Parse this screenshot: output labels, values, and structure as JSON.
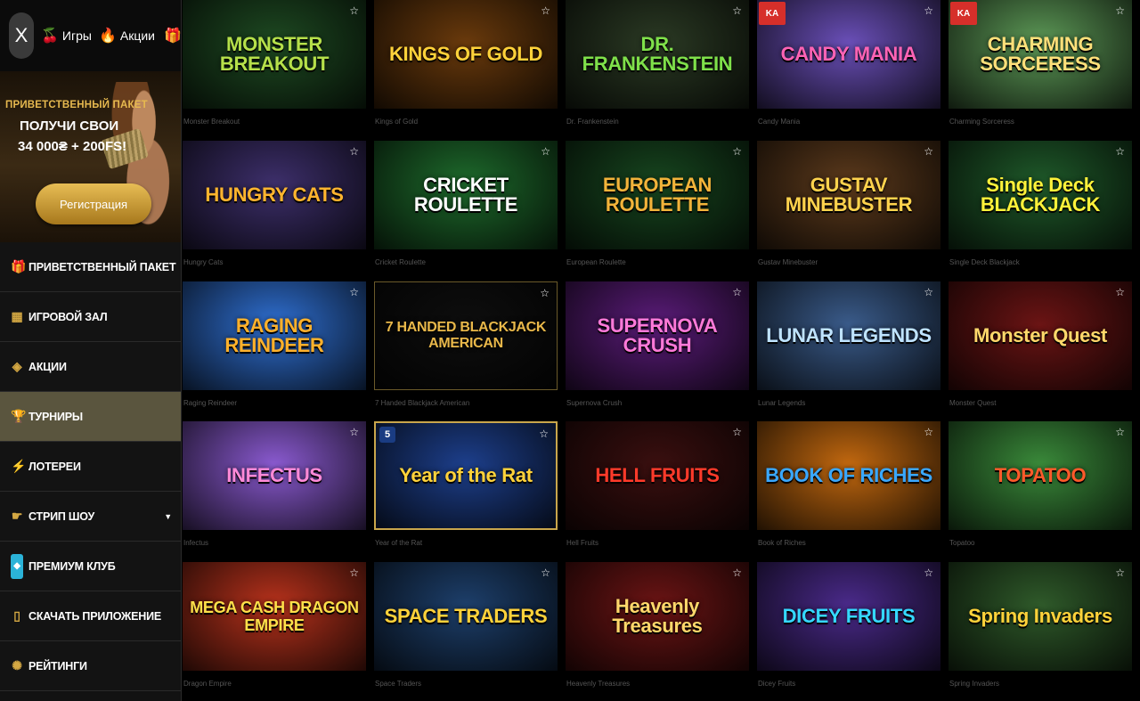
{
  "topbar": {
    "close_label": "X",
    "games_label": "Игры",
    "promos_label": "Акции"
  },
  "promo": {
    "title": "ПРИВЕТСТВЕННЫЙ ПАКЕТ",
    "line1": "ПОЛУЧИ СВОИ",
    "line2": "34 000₴ + 200FS!",
    "button": "Регистрация"
  },
  "menu": [
    {
      "label": "ПРИВЕТСТВЕННЫЙ ПАКЕТ",
      "icon": "gift-icon"
    },
    {
      "label": "ИГРОВОЙ ЗАЛ",
      "icon": "slots-icon"
    },
    {
      "label": "АКЦИИ",
      "icon": "tag-icon"
    },
    {
      "label": "ТУРНИРЫ",
      "icon": "trophy-icon",
      "active": true
    },
    {
      "label": "ЛОТЕРЕИ",
      "icon": "lottery-icon"
    },
    {
      "label": "СТРИП ШОУ",
      "icon": "strip-icon",
      "caret": "▼"
    },
    {
      "label": "ПРЕМИУМ КЛУБ",
      "icon": "club-icon"
    },
    {
      "label": "СКАЧАТЬ ПРИЛОЖЕНИЕ",
      "icon": "phone-icon"
    },
    {
      "label": "РЕЙТИНГИ",
      "icon": "ratings-icon"
    }
  ],
  "games": [
    {
      "title": "MONSTER BREAKOUT",
      "caption": "Monster Breakout",
      "bg": "#1e4a22",
      "fg": "#b6e04a"
    },
    {
      "title": "KINGS OF GOLD",
      "caption": "Kings of Gold",
      "bg": "#6a3a0c",
      "fg": "#ffd23a"
    },
    {
      "title": "DR. FRANKENSTEIN",
      "caption": "Dr. Frankenstein",
      "bg": "#2b3a24",
      "fg": "#7fe04a"
    },
    {
      "title": "CANDY MANIA",
      "caption": "Candy Mania",
      "bg": "#6a4fb8",
      "fg": "#ff63b5"
    },
    {
      "title": "CHARMING SORCERESS",
      "caption": "Charming Sorceress",
      "bg": "#5d9a57",
      "fg": "#ffe07a"
    },
    {
      "title": "HUNGRY CATS",
      "caption": "Hungry Cats",
      "bg": "#3d2f6b",
      "fg": "#ffb52e"
    },
    {
      "title": "CRICKET ROULETTE",
      "caption": "Cricket Roulette",
      "bg": "#1e6b2c",
      "fg": "#ffffff"
    },
    {
      "title": "EUROPEAN ROULETTE",
      "caption": "European Roulette",
      "bg": "#17461f",
      "fg": "#f2b33a"
    },
    {
      "title": "GUSTAV MINEBUSTER",
      "caption": "Gustav Minebuster",
      "bg": "#5c3a1c",
      "fg": "#ffd34d"
    },
    {
      "title": "Single Deck BLACKJACK",
      "caption": "Single Deck Blackjack",
      "bg": "#1f5a2a",
      "fg": "#fff23a"
    },
    {
      "title": "RAGING REINDEER",
      "caption": "Raging Reindeer",
      "bg": "#2f6fd1",
      "fg": "#ffb12b"
    },
    {
      "title": "7 HANDED BLACKJACK AMERICAN",
      "caption": "7 Handed Blackjack American",
      "bg": "#0e0e0e",
      "fg": "#e9b84a"
    },
    {
      "title": "SUPERNOVA CRUSH",
      "caption": "Supernova Crush",
      "bg": "#5b1c7a",
      "fg": "#ff7ad9"
    },
    {
      "title": "LUNAR LEGENDS",
      "caption": "Lunar Legends",
      "bg": "#3a5b8a",
      "fg": "#bfe3ff"
    },
    {
      "title": "Monster Quest",
      "caption": "Monster Quest",
      "bg": "#6b1414",
      "fg": "#ffd86b"
    },
    {
      "title": "INFECTUS",
      "caption": "Infectus",
      "bg": "#8a5ad0",
      "fg": "#ff8ad8"
    },
    {
      "title": "Year of the Rat",
      "caption": "Year of the Rat",
      "bg": "#1d3f8c",
      "fg": "#ffd23a"
    },
    {
      "title": "HELL FRUITS",
      "caption": "Hell Fruits",
      "bg": "#3a0f0f",
      "fg": "#ff3a2a"
    },
    {
      "title": "BOOK OF RICHES",
      "caption": "Book of Riches",
      "bg": "#c2680f",
      "fg": "#3aa8ff"
    },
    {
      "title": "TOPATOO",
      "caption": "Topatoo",
      "bg": "#3a8a3a",
      "fg": "#ff5a2a"
    },
    {
      "title": "MEGA CASH DRAGON EMPIRE",
      "caption": "Dragon Empire",
      "bg": "#b8321c",
      "fg": "#ffe04a"
    },
    {
      "title": "SPACE TRADERS",
      "caption": "Space Traders",
      "bg": "#1d3f6b",
      "fg": "#ffd23a"
    },
    {
      "title": "Heavenly Treasures",
      "caption": "Heavenly Treasures",
      "bg": "#6b1414",
      "fg": "#ffd86b"
    },
    {
      "title": "DICEY FRUITS",
      "caption": "Dicey Fruits",
      "bg": "#4a2a8a",
      "fg": "#35d8ff"
    },
    {
      "title": "Spring Invaders",
      "caption": "Spring Invaders",
      "bg": "#2f5a2a",
      "fg": "#ffd23a"
    }
  ],
  "colors": {
    "accent": "#d4a843",
    "active_menu": "#5a553e",
    "background": "#000000",
    "sidebar": "#121212"
  }
}
